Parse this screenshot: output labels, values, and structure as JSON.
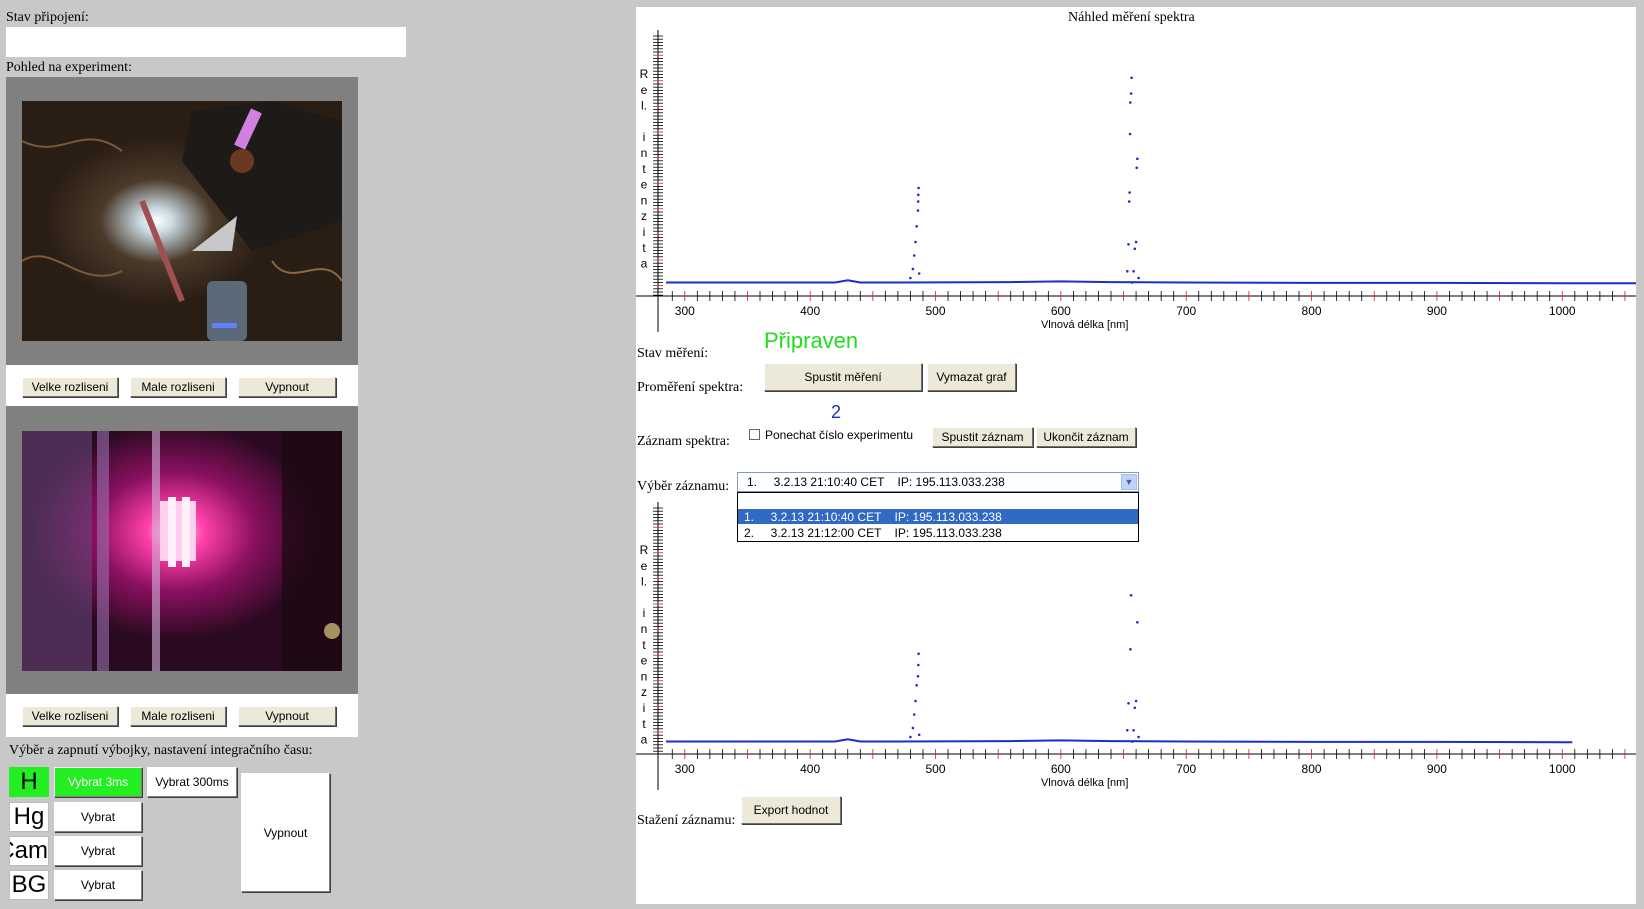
{
  "connection": {
    "label": "Stav připojení:",
    "value": ""
  },
  "camera": {
    "label": "Pohled na experiment:",
    "high_res_label": "Velke rozliseni",
    "low_res_label": "Male rozliseni",
    "off_label": "Vypnout"
  },
  "lamps": {
    "title": "Výběr a zapnutí výbojky, nastavení integračního času:",
    "items": [
      {
        "name": "H",
        "button": "Vybrat 3ms",
        "active": true
      },
      {
        "name": "Hg",
        "button": "Vybrat",
        "active": false
      },
      {
        "name": "Cam",
        "button": "Vybrat",
        "active": false
      },
      {
        "name": "BG",
        "button": "Vybrat",
        "active": false
      }
    ],
    "alt_button": "Vybrat 300ms",
    "off_button": "Vypnout",
    "active_color": "#22ee22"
  },
  "chart_title": "Náhled měření spektra",
  "measurement": {
    "status_label": "Stav měření:",
    "status_value": "Připraven",
    "status_color": "#22dd22",
    "spectrum_label": "Proměření spektra:",
    "start_button": "Spustit měření",
    "clear_button": "Vymazat graf"
  },
  "recording": {
    "label": "Záznam spektra:",
    "experiment_number": "2",
    "keep_checkbox_label": "Ponechat číslo experimentu",
    "keep_checked": false,
    "start_button": "Spustit záznam",
    "stop_button": "Ukončit záznam"
  },
  "record_select": {
    "label": "Výběr záznamu:",
    "selected": "1.     3.2.13 21:10:40 CET    IP: 195.113.033.238",
    "options": [
      "1.     3.2.13 21:10:40 CET    IP: 195.113.033.238",
      "2.     3.2.13 21:12:00 CET    IP: 195.113.033.238"
    ],
    "highlight_color": "#316ac5"
  },
  "download": {
    "label": "Stažení záznamu:",
    "export_button": "Export hodnot"
  },
  "chart_data": [
    {
      "type": "line",
      "title": "Náhled měření spektra",
      "xlabel": "Vlnová délka [nm]",
      "ylabel": "Rel. intenzita",
      "ylabel_chars": [
        "R",
        "e",
        "l.",
        "",
        "i",
        "n",
        "t",
        "e",
        "n",
        "z",
        "i",
        "t",
        "a"
      ],
      "x_ticks": [
        300,
        400,
        500,
        600,
        700,
        800,
        900,
        1000
      ],
      "xlim": [
        285,
        1066
      ],
      "ylim": [
        0,
        1.0
      ],
      "line_color": "#1a2ec8",
      "baseline": [
        [
          285,
          0.02
        ],
        [
          420,
          0.02
        ],
        [
          430,
          0.03
        ],
        [
          435,
          0.025
        ],
        [
          440,
          0.02
        ],
        [
          470,
          0.02
        ],
        [
          560,
          0.022
        ],
        [
          600,
          0.025
        ],
        [
          640,
          0.022
        ],
        [
          700,
          0.02
        ],
        [
          800,
          0.018
        ],
        [
          900,
          0.018
        ],
        [
          1000,
          0.017
        ],
        [
          1066,
          0.017
        ]
      ],
      "peak_points": [
        [
          480,
          0.04
        ],
        [
          482,
          0.08
        ],
        [
          483,
          0.14
        ],
        [
          484,
          0.2
        ],
        [
          485,
          0.27
        ],
        [
          486,
          0.34
        ],
        [
          486.2,
          0.38
        ],
        [
          486.3,
          0.41
        ],
        [
          486.5,
          0.44
        ],
        [
          487,
          0.06
        ],
        [
          653,
          0.07
        ],
        [
          654,
          0.19
        ],
        [
          654.5,
          0.38
        ],
        [
          654.8,
          0.42
        ],
        [
          655.2,
          0.68
        ],
        [
          655.4,
          0.82
        ],
        [
          656,
          0.86
        ],
        [
          656.4,
          0.93
        ],
        [
          657,
          0.02
        ],
        [
          658,
          0.07
        ],
        [
          659,
          0.17
        ],
        [
          660,
          0.2
        ],
        [
          660.5,
          0.53
        ],
        [
          661,
          0.57
        ],
        [
          662,
          0.04
        ]
      ]
    },
    {
      "type": "line",
      "xlabel": "Vlnová délka [nm]",
      "ylabel": "Rel. intenzita",
      "ylabel_chars": [
        "R",
        "e",
        "l.",
        "",
        "i",
        "n",
        "t",
        "e",
        "n",
        "z",
        "i",
        "t",
        "a"
      ],
      "x_ticks": [
        300,
        400,
        500,
        600,
        700,
        800,
        900,
        1000
      ],
      "xlim": [
        285,
        1066
      ],
      "xmax_data": 1008,
      "ylim": [
        0,
        1.0
      ],
      "line_color": "#1a2ec8",
      "baseline": [
        [
          285,
          0.02
        ],
        [
          420,
          0.02
        ],
        [
          430,
          0.03
        ],
        [
          435,
          0.025
        ],
        [
          440,
          0.02
        ],
        [
          470,
          0.02
        ],
        [
          560,
          0.022
        ],
        [
          600,
          0.025
        ],
        [
          640,
          0.022
        ],
        [
          700,
          0.02
        ],
        [
          800,
          0.018
        ],
        [
          900,
          0.018
        ],
        [
          1000,
          0.017
        ],
        [
          1008,
          0.017
        ]
      ],
      "peak_points": [
        [
          480,
          0.04
        ],
        [
          482,
          0.08
        ],
        [
          483,
          0.14
        ],
        [
          484,
          0.2
        ],
        [
          485,
          0.27
        ],
        [
          486,
          0.31
        ],
        [
          486.3,
          0.36
        ],
        [
          486.5,
          0.41
        ],
        [
          487,
          0.05
        ],
        [
          653,
          0.07
        ],
        [
          654,
          0.19
        ],
        [
          655.5,
          0.43
        ],
        [
          656,
          0.67
        ],
        [
          657,
          0.02
        ],
        [
          658,
          0.07
        ],
        [
          659,
          0.17
        ],
        [
          660,
          0.2
        ],
        [
          661,
          0.55
        ],
        [
          662,
          0.04
        ]
      ]
    }
  ]
}
